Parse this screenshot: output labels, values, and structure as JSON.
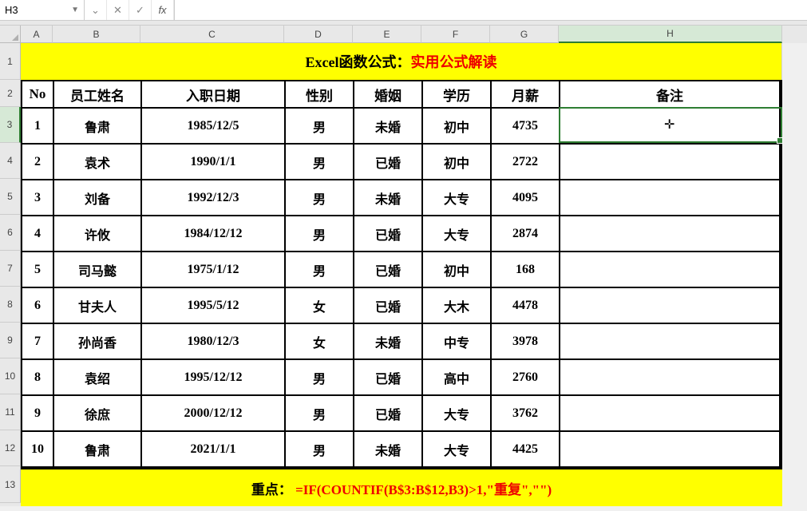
{
  "formula_bar": {
    "cell_ref": "H3",
    "formula": ""
  },
  "columns": [
    "A",
    "B",
    "C",
    "D",
    "E",
    "F",
    "G",
    "H"
  ],
  "row_numbers": [
    1,
    2,
    3,
    4,
    5,
    6,
    7,
    8,
    9,
    10,
    11,
    12,
    13
  ],
  "selected_cell": "H3",
  "title": {
    "prefix": "Excel函数公式：",
    "suffix": "实用公式解读"
  },
  "headers": {
    "no": "No",
    "name": "员工姓名",
    "hire": "入职日期",
    "sex": "性别",
    "marital": "婚姻",
    "edu": "学历",
    "salary": "月薪",
    "remark": "备注"
  },
  "rows": [
    {
      "no": "1",
      "name": "鲁肃",
      "hire": "1985/12/5",
      "sex": "男",
      "marital": "未婚",
      "edu": "初中",
      "salary": "4735",
      "remark": ""
    },
    {
      "no": "2",
      "name": "袁术",
      "hire": "1990/1/1",
      "sex": "男",
      "marital": "已婚",
      "edu": "初中",
      "salary": "2722",
      "remark": ""
    },
    {
      "no": "3",
      "name": "刘备",
      "hire": "1992/12/3",
      "sex": "男",
      "marital": "未婚",
      "edu": "大专",
      "salary": "4095",
      "remark": ""
    },
    {
      "no": "4",
      "name": "许攸",
      "hire": "1984/12/12",
      "sex": "男",
      "marital": "已婚",
      "edu": "大专",
      "salary": "2874",
      "remark": ""
    },
    {
      "no": "5",
      "name": "司马懿",
      "hire": "1975/1/12",
      "sex": "男",
      "marital": "已婚",
      "edu": "初中",
      "salary": "168",
      "remark": ""
    },
    {
      "no": "6",
      "name": "甘夫人",
      "hire": "1995/5/12",
      "sex": "女",
      "marital": "已婚",
      "edu": "大木",
      "salary": "4478",
      "remark": ""
    },
    {
      "no": "7",
      "name": "孙尚香",
      "hire": "1980/12/3",
      "sex": "女",
      "marital": "未婚",
      "edu": "中专",
      "salary": "3978",
      "remark": ""
    },
    {
      "no": "8",
      "name": "袁绍",
      "hire": "1995/12/12",
      "sex": "男",
      "marital": "已婚",
      "edu": "高中",
      "salary": "2760",
      "remark": ""
    },
    {
      "no": "9",
      "name": "徐庶",
      "hire": "2000/12/12",
      "sex": "男",
      "marital": "已婚",
      "edu": "大专",
      "salary": "3762",
      "remark": ""
    },
    {
      "no": "10",
      "name": "鲁肃",
      "hire": "2021/1/1",
      "sex": "男",
      "marital": "未婚",
      "edu": "大专",
      "salary": "4425",
      "remark": ""
    }
  ],
  "bottom": {
    "label": "重点：",
    "formula": "=IF(COUNTIF(B$3:B$12,B3)>1,\"重复\",\"\")"
  },
  "icons": {
    "cancel": "✕",
    "confirm": "✓",
    "fx": "fx",
    "dropdown": "▼",
    "expand": "⌄",
    "cursor": "✛"
  }
}
